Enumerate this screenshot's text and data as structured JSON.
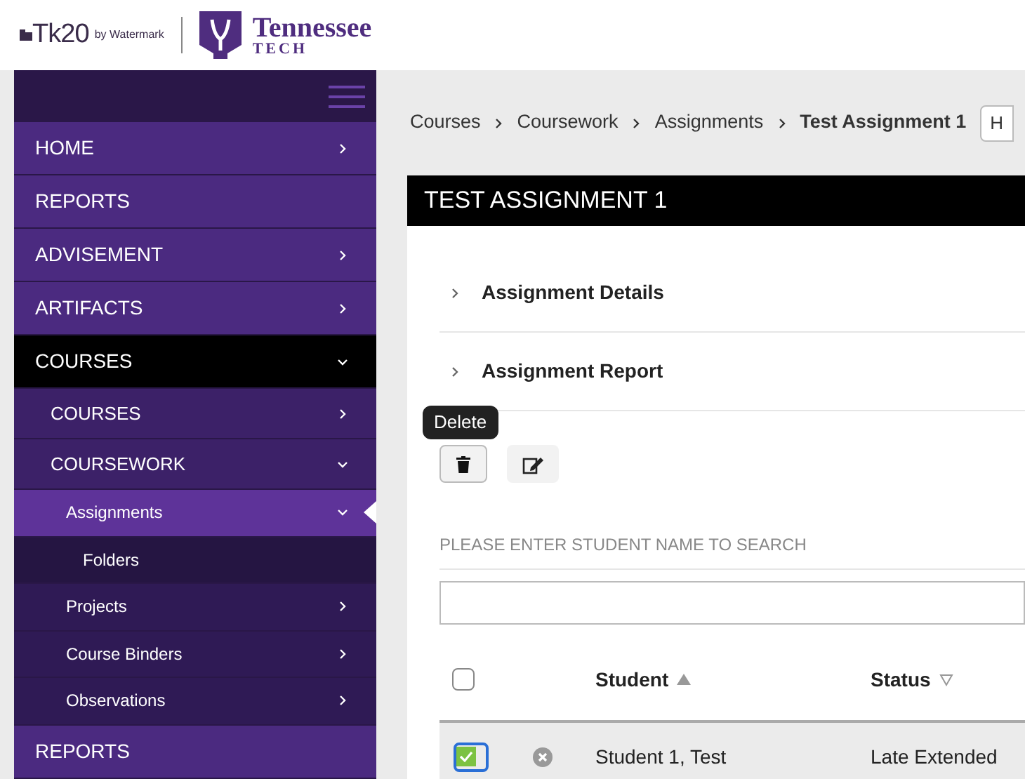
{
  "header": {
    "brand": "Tk20",
    "brand_sub": "by Watermark",
    "school": "Tennessee",
    "school_sub": "TECH"
  },
  "sidebar": {
    "items": [
      {
        "label": "HOME",
        "expanded": false,
        "selected": false
      },
      {
        "label": "REPORTS",
        "selected": false
      },
      {
        "label": "ADVISEMENT",
        "expanded": false,
        "selected": false
      },
      {
        "label": "ARTIFACTS",
        "expanded": false,
        "selected": false
      },
      {
        "label": "COURSES",
        "expanded": true,
        "selected": false,
        "children": [
          {
            "label": "COURSES",
            "expanded": false,
            "selected": false
          },
          {
            "label": "COURSEWORK",
            "expanded": true,
            "selected": false,
            "children": [
              {
                "label": "Assignments",
                "expanded": true,
                "selected": true,
                "children": [
                  {
                    "label": "Folders",
                    "selected": false
                  }
                ]
              },
              {
                "label": "Projects",
                "expanded": false,
                "selected": false
              },
              {
                "label": "Course Binders",
                "expanded": false,
                "selected": false
              },
              {
                "label": "Observations",
                "expanded": false,
                "selected": false
              }
            ]
          }
        ]
      },
      {
        "label": "REPORTS",
        "selected": false
      }
    ]
  },
  "breadcrumb": [
    "Courses",
    "Coursework",
    "Assignments",
    "Test Assignment 1"
  ],
  "help_button": "H",
  "page_title": "TEST ASSIGNMENT 1",
  "sections": [
    {
      "label": "Assignment Details",
      "expanded": false
    },
    {
      "label": "Assignment Report",
      "expanded": false
    }
  ],
  "tooltip": "Delete",
  "search": {
    "label": "PLEASE ENTER STUDENT NAME TO SEARCH"
  },
  "table": {
    "select_all": {
      "checked": false
    },
    "columns": [
      {
        "label": "Student",
        "sort_ascending": true
      },
      {
        "label": "Status",
        "sort_ascending": false
      }
    ],
    "rows": [
      {
        "checked": true,
        "student": "Student 1, Test",
        "status": "Late Extended"
      }
    ]
  }
}
